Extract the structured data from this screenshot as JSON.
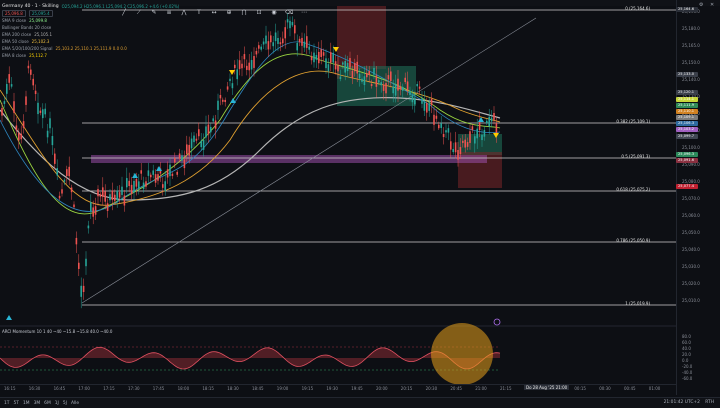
{
  "symbol": {
    "title": "Germany 40 · 1 · Skilling",
    "ohlc": "O25,094.2 H25,096.1 L25,094.2 C25,096.2 +4.6 (+0.02%)",
    "price_box_1": "25,096.8",
    "price_box_2": "25,095.4"
  },
  "legend": [
    {
      "label": "SMA 9 close",
      "value": "25,099.8",
      "color": "#8ef58e"
    },
    {
      "label": "Bollinger Bands 20 close",
      "value": "",
      "color": "#888888"
    },
    {
      "label": "EMA 200 close",
      "value": "25,105.1",
      "color": "#b0b0b0"
    },
    {
      "label": "EMA 50 close",
      "value": "25,102.3",
      "color": "#f0c040"
    },
    {
      "label": "EMA 5/20/100/200 Signal",
      "value": "25,103.2 25,110.1 25,111.9 0.0 0.0",
      "color": "#e0a030"
    },
    {
      "label": "EMA 8 close",
      "value": "25,112.7",
      "color": "#ffd400"
    }
  ],
  "price_ticks": [
    "25,195.0",
    "25,180.0",
    "25,165.0",
    "25,150.0",
    "25,140.0",
    "25,130.0",
    "25,120.0",
    "25,110.0",
    "25,100.0",
    "25,090.0",
    "25,080.0",
    "25,070.0",
    "25,060.0",
    "25,050.0",
    "25,040.0",
    "25,030.0",
    "25,020.0",
    "25,010.0"
  ],
  "price_tags": [
    {
      "text": "25,164.6",
      "color": "#2b2f38"
    },
    {
      "text": "25,133.0",
      "color": "#3a3f4a"
    },
    {
      "text": "25,120.1",
      "color": "#3a3f4a"
    },
    {
      "text": "25,114.1",
      "color": "#c6d63a"
    },
    {
      "text": "25,111.9",
      "color": "#2e8b57"
    },
    {
      "text": "25,110.1",
      "color": "#d08020"
    },
    {
      "text": "25,109.1",
      "color": "#7a7a7a"
    },
    {
      "text": "25,106.3",
      "color": "#2e6ba0"
    },
    {
      "text": "25,103.2",
      "color": "#a060c0"
    },
    {
      "text": "25,099.7",
      "color": "#404652"
    },
    {
      "text": "25,096.3",
      "color": "#2b8a5b"
    },
    {
      "text": "25,091.6",
      "color": "#8a3040"
    },
    {
      "text": "25,077.4",
      "color": "#c02030"
    }
  ],
  "fib_levels": [
    {
      "label": "0 (25,164.6)"
    },
    {
      "label": "0.382 (25,109.1)"
    },
    {
      "label": "0.5 (25,091.3)"
    },
    {
      "label": "0.618 (25,075.2)"
    },
    {
      "label": "0.786 (25,050.9)"
    },
    {
      "label": "1 (25,019.9)"
    }
  ],
  "momentum": {
    "title": "ARCI Momentum 10 1 40 ~40 ~15.8 ~15.8 40.0 ~40.0",
    "ticks": [
      "80.0",
      "60.0",
      "40.0",
      "20.0",
      "0.0",
      "-20.0",
      "-40.0",
      "-60.0"
    ]
  },
  "time_labels": [
    "16:15",
    "16:30",
    "16:45",
    "17:00",
    "17:15",
    "17:30",
    "17:45",
    "18:00",
    "18:15",
    "18:30",
    "18:45",
    "19:00",
    "19:15",
    "19:30",
    "19:45",
    "20:00",
    "20:15",
    "20:30",
    "20:45",
    "21:00",
    "21:15",
    "21:30",
    "29",
    "00:15",
    "00:30",
    "00:45",
    "01:00"
  ],
  "time_highlight": "Do 28 Aug '25  21:00",
  "timeframes": [
    "1T",
    "5T",
    "1M",
    "3M",
    "6M",
    "1J",
    "5J",
    "Alle"
  ],
  "clock": "21:01:42 UTC+2",
  "adj": "RTH",
  "colors": {
    "bull": "#26a69a",
    "bear": "#ef5350",
    "bg": "#0d0f14"
  }
}
